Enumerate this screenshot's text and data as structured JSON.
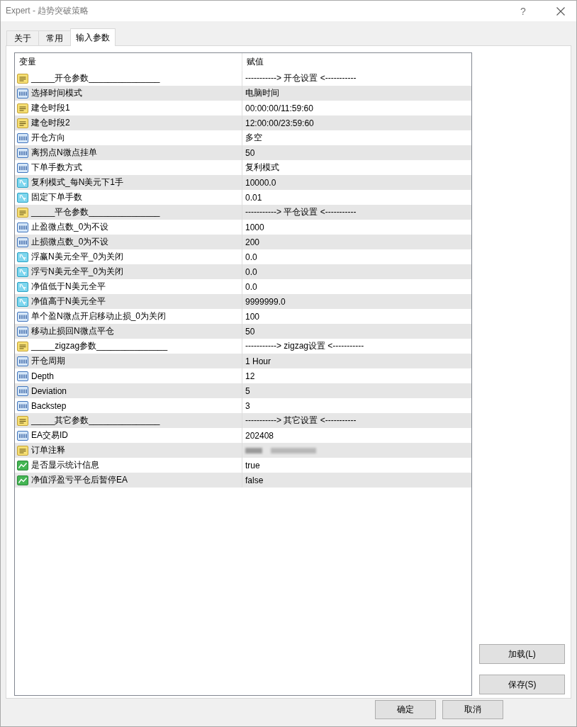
{
  "window": {
    "title": "Expert - 趋势突破策略",
    "help": "?"
  },
  "tabs": [
    {
      "label": "关于",
      "selected": false
    },
    {
      "label": "常用",
      "selected": false
    },
    {
      "label": "输入参数",
      "selected": true
    }
  ],
  "table": {
    "columns": [
      "变量",
      "赋值"
    ],
    "rows": [
      {
        "kind": "string",
        "name": "_____开仓参数_______________",
        "value": "-----------> 开仓设置 <-----------",
        "blurred": false
      },
      {
        "kind": "int",
        "name": "选择时间模式",
        "value": "电脑时间",
        "blurred": false
      },
      {
        "kind": "string",
        "name": "建仓时段1",
        "value": "00:00:00/11:59:60",
        "blurred": false
      },
      {
        "kind": "string",
        "name": "建仓时段2",
        "value": "12:00:00/23:59:60",
        "blurred": false
      },
      {
        "kind": "int",
        "name": "开仓方向",
        "value": "多空",
        "blurred": false
      },
      {
        "kind": "int",
        "name": "离拐点N微点挂单",
        "value": "50",
        "blurred": false
      },
      {
        "kind": "int",
        "name": "下单手数方式",
        "value": "复利模式",
        "blurred": false
      },
      {
        "kind": "double",
        "name": "复利模式_每N美元下1手",
        "value": "10000.0",
        "blurred": false
      },
      {
        "kind": "double",
        "name": "固定下单手数",
        "value": "0.01",
        "blurred": false
      },
      {
        "kind": "string",
        "name": "_____平仓参数_______________",
        "value": "-----------> 平仓设置 <-----------",
        "blurred": false
      },
      {
        "kind": "int",
        "name": "止盈微点数_0为不设",
        "value": "1000",
        "blurred": false
      },
      {
        "kind": "int",
        "name": "止损微点数_0为不设",
        "value": "200",
        "blurred": false
      },
      {
        "kind": "double",
        "name": "浮赢N美元全平_0为关闭",
        "value": "0.0",
        "blurred": false
      },
      {
        "kind": "double",
        "name": "浮亏N美元全平_0为关闭",
        "value": "0.0",
        "blurred": false
      },
      {
        "kind": "double",
        "name": "净值低于N美元全平",
        "value": "0.0",
        "blurred": false
      },
      {
        "kind": "double",
        "name": "净值高于N美元全平",
        "value": "9999999.0",
        "blurred": false
      },
      {
        "kind": "int",
        "name": "单个盈N微点开启移动止损_0为关闭",
        "value": "100",
        "blurred": false
      },
      {
        "kind": "int",
        "name": "移动止损回N微点平仓",
        "value": "50",
        "blurred": false
      },
      {
        "kind": "string",
        "name": "_____zigzag参数_______________",
        "value": "-----------> zigzag设置 <-----------",
        "blurred": false
      },
      {
        "kind": "int",
        "name": "开仓周期",
        "value": "1 Hour",
        "blurred": false
      },
      {
        "kind": "int",
        "name": "Depth",
        "value": "12",
        "blurred": false
      },
      {
        "kind": "int",
        "name": "Deviation",
        "value": "5",
        "blurred": false
      },
      {
        "kind": "int",
        "name": "Backstep",
        "value": "3",
        "blurred": false
      },
      {
        "kind": "string",
        "name": "_____其它参数_______________",
        "value": "-----------> 其它设置 <-----------",
        "blurred": false
      },
      {
        "kind": "int",
        "name": "EA交易ID",
        "value": "202408",
        "blurred": false
      },
      {
        "kind": "string",
        "name": "订单注释",
        "blurred": true
      },
      {
        "kind": "bool",
        "name": "是否显示统计信息",
        "value": "true",
        "blurred": false
      },
      {
        "kind": "bool",
        "name": "净值浮盈亏平仓后暂停EA",
        "value": "false",
        "blurred": false
      }
    ]
  },
  "side_buttons": [
    "加载(L)",
    "保存(S)"
  ],
  "footer_buttons": [
    "确定",
    "取消"
  ]
}
